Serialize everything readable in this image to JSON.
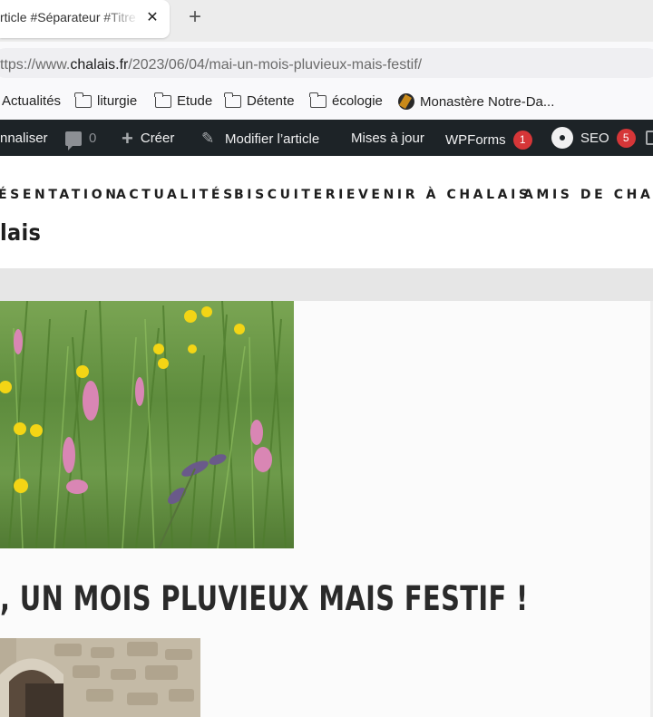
{
  "browser": {
    "tab": {
      "title": "rticle #Séparateur #Titre",
      "close_glyph": "✕"
    },
    "new_tab_glyph": "+",
    "address": {
      "prefix": "ttps://www.",
      "domain": "chalais.fr",
      "path": "/2023/06/04/mai-un-mois-pluvieux-mais-festif/"
    },
    "bookmarks": [
      {
        "label": "Actualités",
        "icon": "none"
      },
      {
        "label": "liturgie",
        "icon": "folder-icon"
      },
      {
        "label": "Etude",
        "icon": "folder-icon"
      },
      {
        "label": "Détente",
        "icon": "folder-icon"
      },
      {
        "label": "écologie",
        "icon": "folder-icon"
      },
      {
        "label": "Monastère Notre-Da...",
        "icon": "site-favicon"
      }
    ]
  },
  "adminbar": {
    "customize": "nnaliser",
    "comments_count": "0",
    "create": "Créer",
    "edit_post": "Modifier l’article",
    "updates": "Mises à jour",
    "wpforms": "WPForms",
    "wpforms_badge": "1",
    "seo": "SEO",
    "seo_badge": "5"
  },
  "site": {
    "nav": [
      "ÉSENTATION",
      "ACTUALITÉS",
      "BISCUITERIE",
      "VENIR À CHALAIS",
      "AMIS DE CHALA"
    ],
    "title": "lais"
  },
  "article": {
    "title": ", UN MOIS PLUVIEUX MAIS FESTIF !"
  },
  "colors": {
    "adminbar_bg": "#1d2327",
    "badge_red": "#d63638",
    "text_dark": "#1e1e1e"
  }
}
